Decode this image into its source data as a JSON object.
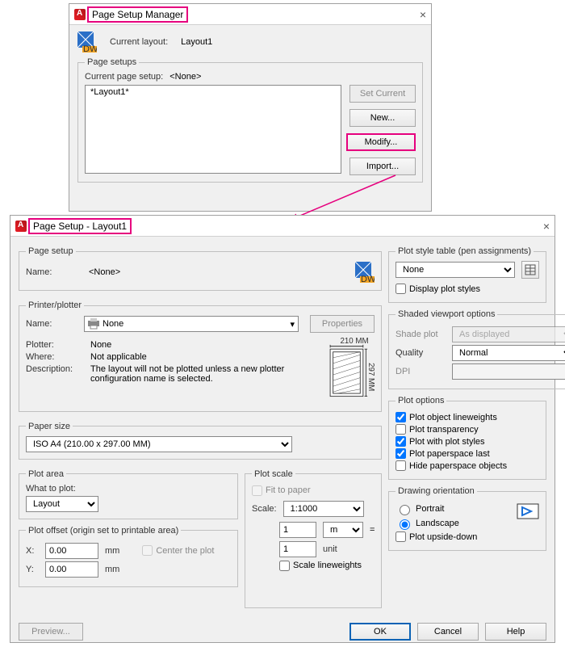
{
  "mgr": {
    "title": "Page Setup Manager",
    "current_layout_label": "Current layout:",
    "current_layout": "Layout1",
    "page_setups_legend": "Page setups",
    "current_page_setup_label": "Current page setup:",
    "current_page_setup": "<None>",
    "list": [
      "*Layout1*"
    ],
    "buttons": {
      "set_current": "Set Current",
      "new": "New...",
      "modify": "Modify...",
      "import": "Import..."
    }
  },
  "dlg": {
    "title": "Page Setup - Layout1",
    "page_setup_legend": "Page setup",
    "name_label": "Name:",
    "name_value": "<None>",
    "printer_legend": "Printer/plotter",
    "printer_name_label": "Name:",
    "printer_name_value": "None",
    "properties_btn": "Properties",
    "plotter_label": "Plotter:",
    "plotter_value": "None",
    "where_label": "Where:",
    "where_value": "Not applicable",
    "desc_label": "Description:",
    "desc_value": "The layout will not be plotted unless a new plotter configuration name is selected.",
    "paper_w_label": "210 MM",
    "paper_h_label": "297 MM",
    "paper_size_legend": "Paper size",
    "paper_size_value": "ISO A4 (210.00 x 297.00 MM)",
    "plot_area_legend": "Plot area",
    "what_to_plot_label": "What to plot:",
    "what_to_plot_value": "Layout",
    "plot_offset_legend": "Plot offset (origin set to printable area)",
    "x_label": "X:",
    "x_value": "0.00",
    "y_label": "Y:",
    "y_value": "0.00",
    "mm_unit": "mm",
    "center_label": "Center the plot",
    "plot_scale_legend": "Plot scale",
    "fit_label": "Fit to paper",
    "scale_label": "Scale:",
    "scale_value": "1:1000",
    "factor_a": "1",
    "factor_a_unit": "mm",
    "equals": "=",
    "factor_b": "1",
    "factor_b_unit": "unit",
    "scale_lw_label": "Scale lineweights",
    "pst_legend": "Plot style table (pen assignments)",
    "pst_value": "None",
    "display_ps_label": "Display plot styles",
    "svo_legend": "Shaded viewport options",
    "shade_plot_label": "Shade plot",
    "shade_plot_value": "As displayed",
    "quality_label": "Quality",
    "quality_value": "Normal",
    "dpi_label": "DPI",
    "plot_options_legend": "Plot options",
    "polw": "Plot object lineweights",
    "ptrans": "Plot transparency",
    "pwps": "Plot with plot styles",
    "ppl": "Plot paperspace last",
    "hpo": "Hide paperspace objects",
    "orient_legend": "Drawing orientation",
    "portrait": "Portrait",
    "landscape": "Landscape",
    "upside": "Plot upside-down",
    "preview_btn": "Preview...",
    "ok_btn": "OK",
    "cancel_btn": "Cancel",
    "help_btn": "Help"
  }
}
